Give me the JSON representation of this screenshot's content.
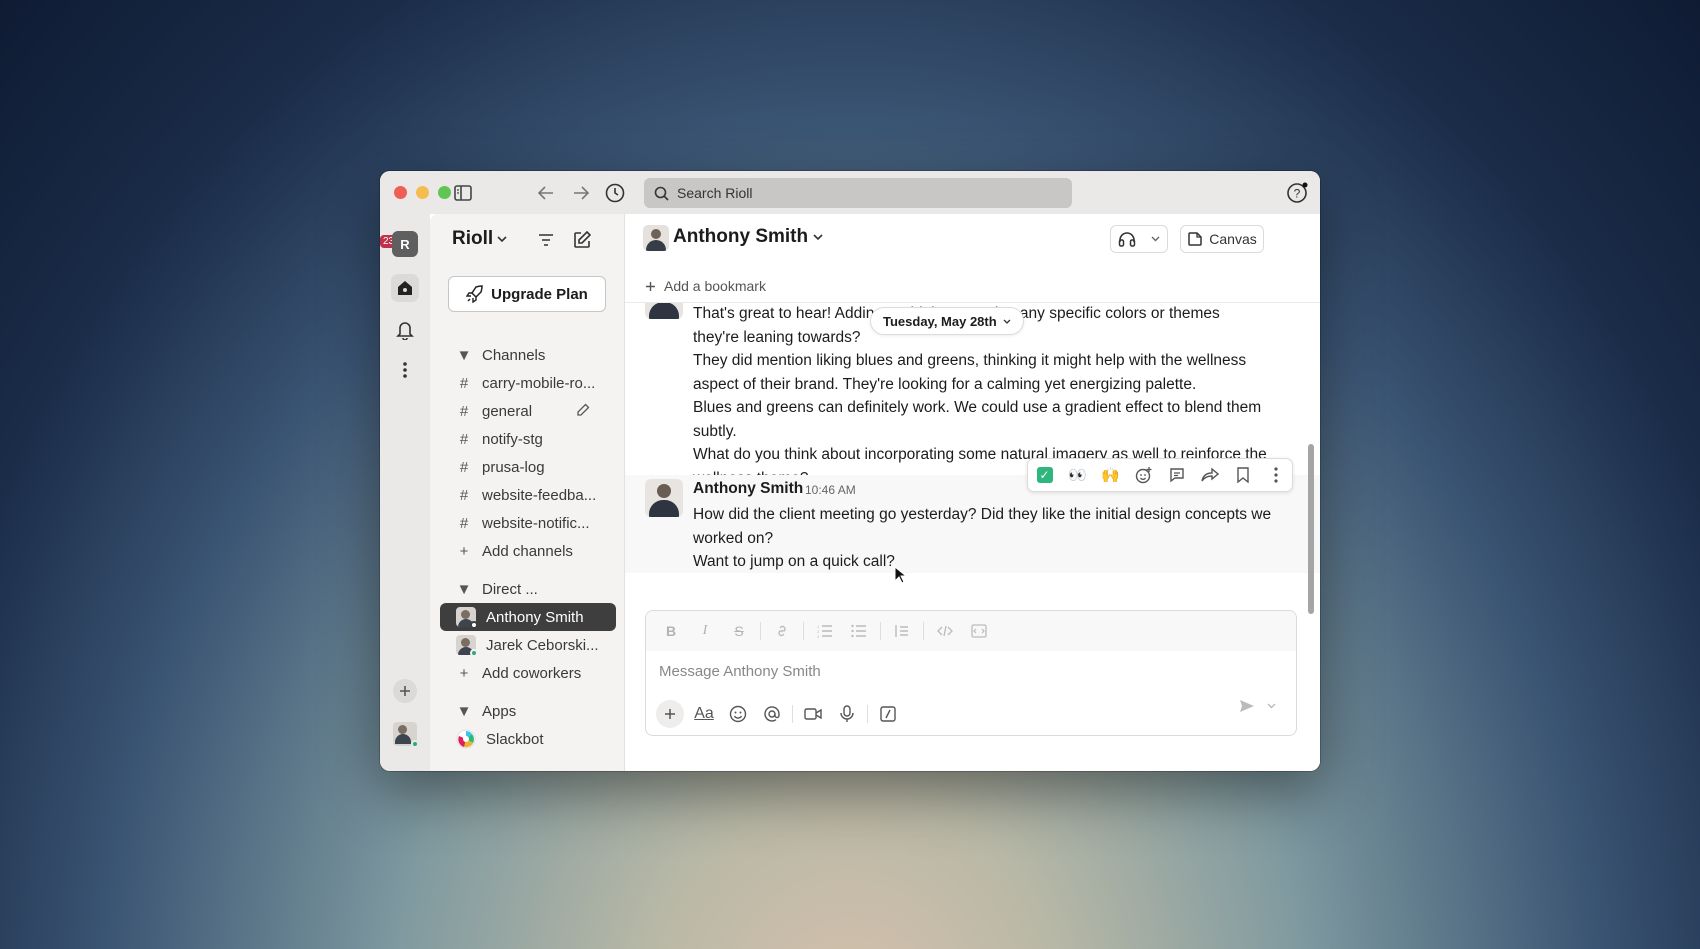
{
  "window": {
    "search_placeholder": "Search Rioll",
    "workspace_initial": "R",
    "notification_badge": "23"
  },
  "sidebar": {
    "workspace_name": "Rioll",
    "upgrade_label": "Upgrade Plan",
    "channels_header": "Channels",
    "channels": [
      {
        "label": "carry-mobile-ro..."
      },
      {
        "label": "general"
      },
      {
        "label": "notify-stg"
      },
      {
        "label": "prusa-log"
      },
      {
        "label": "website-feedba..."
      },
      {
        "label": "website-notific..."
      }
    ],
    "add_channels": "Add channels",
    "dm_header": "Direct ...",
    "dms": [
      {
        "label": "Anthony Smith"
      },
      {
        "label": "Jarek Ceborski..."
      }
    ],
    "add_coworkers": "Add coworkers",
    "apps_header": "Apps",
    "apps": [
      {
        "label": "Slackbot"
      }
    ]
  },
  "channel": {
    "title": "Anthony Smith",
    "canvas_label": "Canvas",
    "bookmark_label": "Add a bookmark"
  },
  "messages": {
    "date_divider": "Tuesday, May 28th",
    "earlier_lines": [
      "That's great to hear! Adding c             Did they mention any specific colors or themes",
      "they're leaning towards?",
      "They did mention liking blues and greens, thinking it might help with the wellness",
      "aspect of their brand. They're looking for a calming yet energizing palette.",
      "Blues and greens can definitely work. We could use a gradient effect to blend them",
      "subtly.",
      "What do you think about incorporating some natural imagery as well to reinforce the",
      "wellness theme?"
    ],
    "last": {
      "author": "Anthony Smith",
      "time": "10:46 AM",
      "lines": [
        "How did the client meeting go yesterday? Did they like the initial design concepts we",
        "worked on?",
        "Want to jump on a quick call?"
      ]
    }
  },
  "composer": {
    "placeholder": "Message Anthony Smith",
    "format_label": "Aa"
  },
  "colors": {
    "active_item": "#3f3e3f",
    "online": "#2bac76",
    "badge": "#c2314a",
    "check": "#2eb67d"
  }
}
